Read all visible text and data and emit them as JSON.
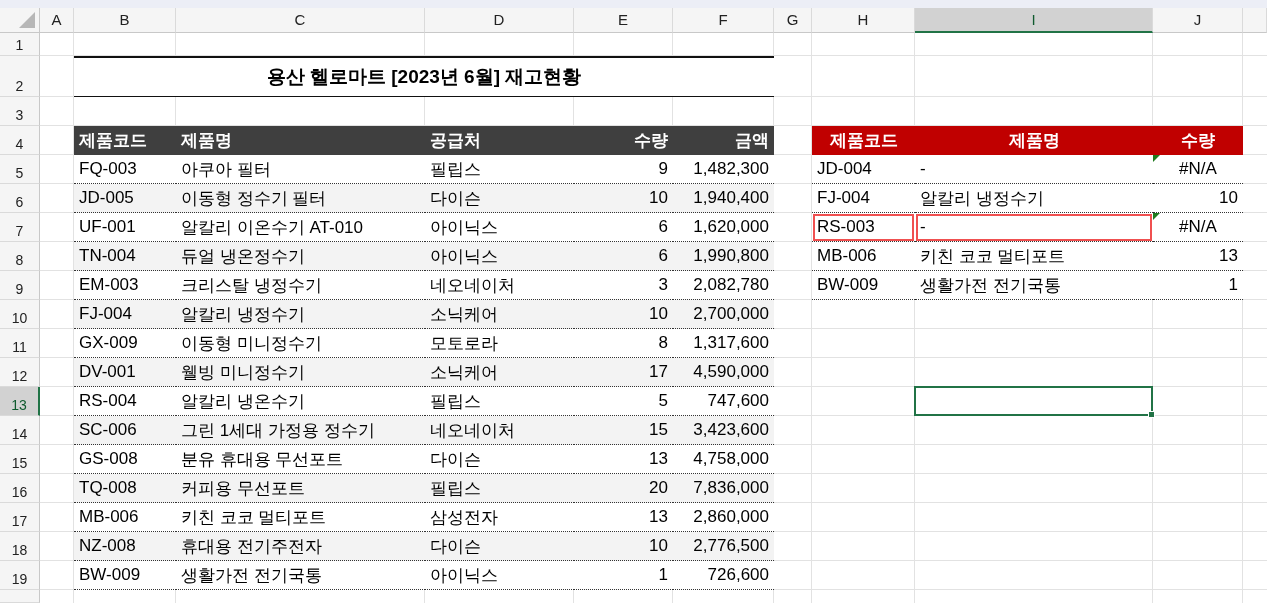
{
  "column_headers": [
    {
      "label": "A",
      "selected": false
    },
    {
      "label": "B",
      "selected": false
    },
    {
      "label": "C",
      "selected": false
    },
    {
      "label": "D",
      "selected": false
    },
    {
      "label": "E",
      "selected": false
    },
    {
      "label": "F",
      "selected": false
    },
    {
      "label": "G",
      "selected": false
    },
    {
      "label": "H",
      "selected": false
    },
    {
      "label": "I",
      "selected": true
    },
    {
      "label": "J",
      "selected": false
    }
  ],
  "row_headers": [
    {
      "label": "1",
      "selected": false
    },
    {
      "label": "2",
      "selected": false
    },
    {
      "label": "3",
      "selected": false
    },
    {
      "label": "4",
      "selected": false
    },
    {
      "label": "5",
      "selected": false
    },
    {
      "label": "6",
      "selected": false
    },
    {
      "label": "7",
      "selected": false
    },
    {
      "label": "8",
      "selected": false
    },
    {
      "label": "9",
      "selected": false
    },
    {
      "label": "10",
      "selected": false
    },
    {
      "label": "11",
      "selected": false
    },
    {
      "label": "12",
      "selected": false
    },
    {
      "label": "13",
      "selected": true
    },
    {
      "label": "14",
      "selected": false
    },
    {
      "label": "15",
      "selected": false
    },
    {
      "label": "16",
      "selected": false
    },
    {
      "label": "17",
      "selected": false
    },
    {
      "label": "18",
      "selected": false
    },
    {
      "label": "19",
      "selected": false
    }
  ],
  "title": "용산 헬로마트 [2023년 6월] 재고현황",
  "inventory_table": {
    "columns": [
      "제품코드",
      "제품명",
      "공급처",
      "수량",
      "금액"
    ],
    "rows": [
      {
        "code": "FQ-003",
        "name": "아쿠아 필터",
        "supplier": "필립스",
        "qty": "9",
        "amount": "1,482,300"
      },
      {
        "code": "JD-005",
        "name": "이동형 정수기 필터",
        "supplier": "다이슨",
        "qty": "10",
        "amount": "1,940,400"
      },
      {
        "code": "UF-001",
        "name": "알칼리 이온수기 AT-010",
        "supplier": "아이닉스",
        "qty": "6",
        "amount": "1,620,000"
      },
      {
        "code": "TN-004",
        "name": "듀얼 냉온정수기",
        "supplier": "아이닉스",
        "qty": "6",
        "amount": "1,990,800"
      },
      {
        "code": "EM-003",
        "name": "크리스탈 냉정수기",
        "supplier": "네오네이처",
        "qty": "3",
        "amount": "2,082,780"
      },
      {
        "code": "FJ-004",
        "name": "알칼리 냉정수기",
        "supplier": "소닉케어",
        "qty": "10",
        "amount": "2,700,000"
      },
      {
        "code": "GX-009",
        "name": "이동형 미니정수기",
        "supplier": "모토로라",
        "qty": "8",
        "amount": "1,317,600"
      },
      {
        "code": "DV-001",
        "name": "웰빙 미니정수기",
        "supplier": "소닉케어",
        "qty": "17",
        "amount": "4,590,000"
      },
      {
        "code": "RS-004",
        "name": "알칼리 냉온수기",
        "supplier": "필립스",
        "qty": "5",
        "amount": "747,600"
      },
      {
        "code": "SC-006",
        "name": "그린 1세대 가정용 정수기",
        "supplier": "네오네이처",
        "qty": "15",
        "amount": "3,423,600"
      },
      {
        "code": "GS-008",
        "name": "분유 휴대용 무선포트",
        "supplier": "다이슨",
        "qty": "13",
        "amount": "4,758,000"
      },
      {
        "code": "TQ-008",
        "name": "커피용 무선포트",
        "supplier": "필립스",
        "qty": "20",
        "amount": "7,836,000"
      },
      {
        "code": "MB-006",
        "name": "키친 코코 멀티포트",
        "supplier": "삼성전자",
        "qty": "13",
        "amount": "2,860,000"
      },
      {
        "code": "NZ-008",
        "name": "휴대용 전기주전자",
        "supplier": "다이슨",
        "qty": "10",
        "amount": "2,776,500"
      },
      {
        "code": "BW-009",
        "name": "생활가전 전기국통",
        "supplier": "아이닉스",
        "qty": "1",
        "amount": "726,600"
      }
    ]
  },
  "lookup_table": {
    "columns": [
      "제품코드",
      "제품명",
      "수량"
    ],
    "rows": [
      {
        "code": "JD-004",
        "name": "-",
        "qty": "#N/A",
        "error": true,
        "highlighted": false
      },
      {
        "code": "FJ-004",
        "name": "알칼리 냉정수기",
        "qty": "10",
        "error": false,
        "highlighted": false
      },
      {
        "code": "RS-003",
        "name": "-",
        "qty": "#N/A",
        "error": true,
        "highlighted": true
      },
      {
        "code": "MB-006",
        "name": "키친 코코 멀티포트",
        "qty": "13",
        "error": false,
        "highlighted": false
      },
      {
        "code": "BW-009",
        "name": "생활가전 전기국통",
        "qty": "1",
        "error": false,
        "highlighted": false
      }
    ]
  }
}
